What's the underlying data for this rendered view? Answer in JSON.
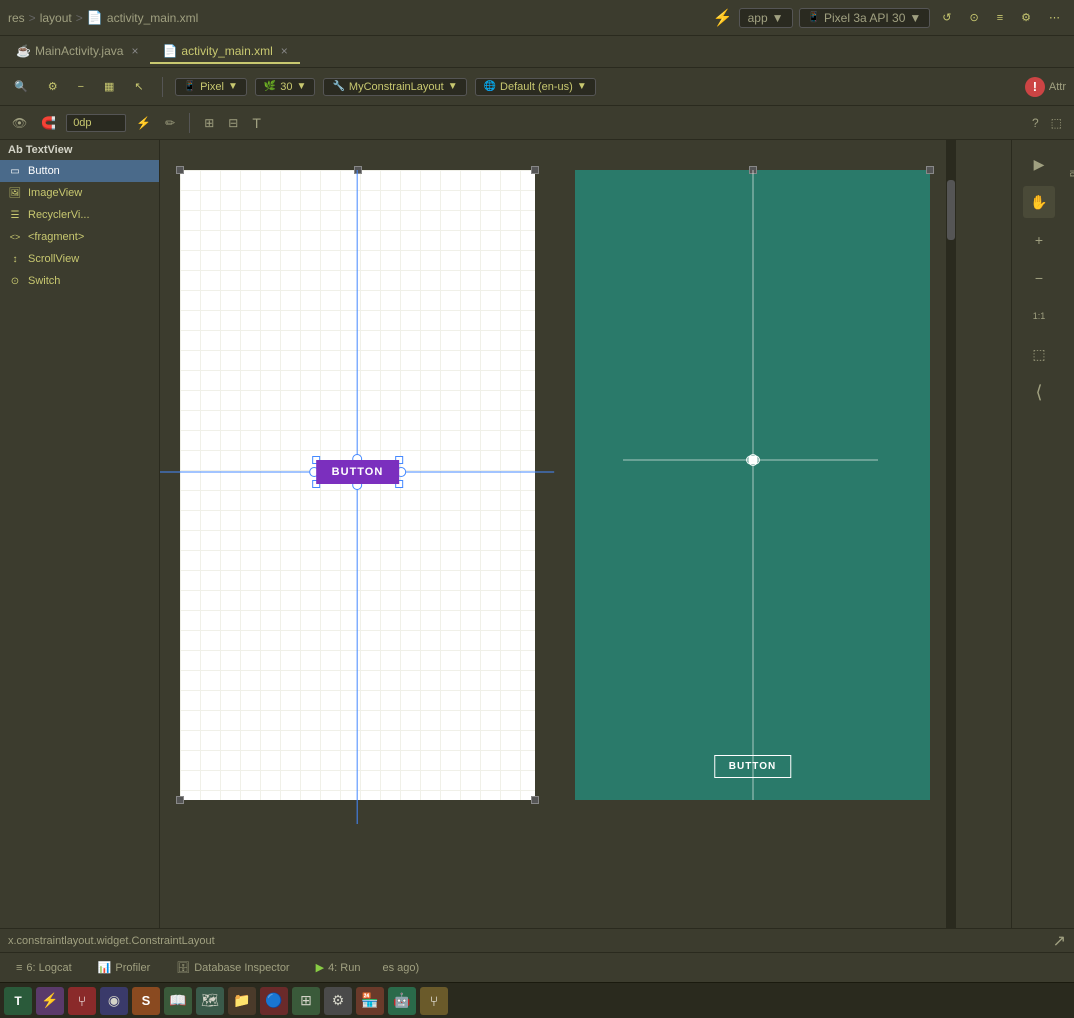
{
  "breadcrumb": {
    "parts": [
      "res",
      "layout",
      "activity_main.xml"
    ],
    "separators": [
      ">",
      ">"
    ]
  },
  "toolbar": {
    "device": "Pixel",
    "api": "30",
    "layout": "MyConstrainLayout",
    "locale": "Default (en-us)",
    "zoom_icon": "🔍",
    "settings_icon": "⚙",
    "minus_icon": "−",
    "palette_icon": "▦",
    "cursor_icon": "↖",
    "warning_label": "!",
    "attrs_label": "Attr"
  },
  "tabs": [
    {
      "label": "MainActivity.java",
      "active": false
    },
    {
      "label": "activity_main.xml",
      "active": true
    }
  ],
  "sec_toolbar": {
    "eye_icon": "👁",
    "magnet_icon": "🧲",
    "margin_value": "0dp",
    "path_icon": "⚡",
    "brush_icon": "✏",
    "align_h_icon": "⊞",
    "align_v_icon": "⊟",
    "baseline_icon": "T"
  },
  "palette": {
    "header": "Ab TextView",
    "items": [
      {
        "id": "button",
        "label": "Button",
        "icon": "▭",
        "selected": true
      },
      {
        "id": "imageview",
        "label": "ImageView",
        "icon": "🖼"
      },
      {
        "id": "recyclerview",
        "label": "RecyclerVi...",
        "icon": "☰"
      },
      {
        "id": "fragment",
        "label": "<fragment>",
        "icon": "<>"
      },
      {
        "id": "scrollview",
        "label": "ScrollView",
        "icon": "↕"
      },
      {
        "id": "switch",
        "label": "Switch",
        "icon": "⊙"
      }
    ]
  },
  "canvas": {
    "design_button_label": "BUTTON",
    "blueprint_button_label": "BUTTON"
  },
  "right_panel": {
    "play_icon": "▶",
    "hand_icon": "✋",
    "zoom_in_icon": "+",
    "zoom_out_icon": "−",
    "fit_icon": "1:1",
    "crop_icon": "⬚",
    "expand_icon": "⟨"
  },
  "status_bar": {
    "class_path": "x.constraintlayout.widget.ConstraintLayout",
    "cursor_icon": "↗"
  },
  "bottom_tabs": [
    {
      "id": "logcat",
      "label": "6: Logcat",
      "icon": "≡"
    },
    {
      "id": "profiler",
      "label": "Profiler",
      "icon": "📊"
    },
    {
      "id": "database",
      "label": "Database Inspector",
      "icon": "🗄"
    },
    {
      "id": "run",
      "label": "4: Run",
      "icon": "▶"
    }
  ],
  "status_bottom": {
    "time_ago": "es ago)"
  },
  "taskbar_icons": [
    {
      "id": "terminal",
      "color": "#3a7a3a",
      "char": "T"
    },
    {
      "id": "android",
      "color": "#8a4a8a",
      "char": "⚡"
    },
    {
      "id": "git",
      "color": "#c04040",
      "char": "⑂"
    },
    {
      "id": "colorwheel",
      "color": "#4a4a8a",
      "char": "◉"
    },
    {
      "id": "sublime",
      "color": "#c06030",
      "char": "S"
    },
    {
      "id": "book",
      "color": "#4a8a4a",
      "char": "📖"
    },
    {
      "id": "maps",
      "color": "#5a8a5a",
      "char": "🗺"
    },
    {
      "id": "folder",
      "color": "#6a6a3a",
      "char": "📁"
    },
    {
      "id": "chrome",
      "color": "#8a3030",
      "char": "🔵"
    },
    {
      "id": "table",
      "color": "#4a6a4a",
      "char": "⊞"
    },
    {
      "id": "settings",
      "color": "#5a5a5a",
      "char": "⚙"
    },
    {
      "id": "store",
      "color": "#8a4a3a",
      "char": "🏪"
    },
    {
      "id": "android2",
      "color": "#3a8a5a",
      "char": "🤖"
    },
    {
      "id": "git2",
      "color": "#8a7a3a",
      "char": "⑂"
    }
  ]
}
